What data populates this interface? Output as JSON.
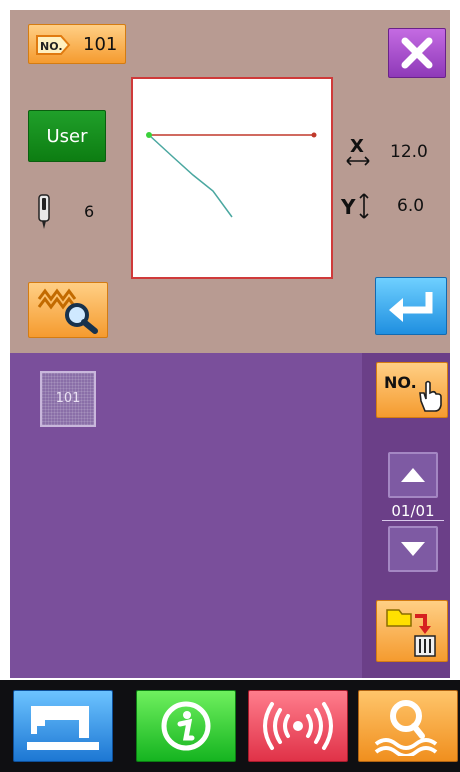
{
  "header": {
    "program_no_label": "NO.",
    "program_no": "101"
  },
  "params": {
    "needle_value": "6",
    "x_value": "12.0",
    "y_value": "6.0"
  },
  "buttons": {
    "user_label": "User",
    "no_select_label": "NO."
  },
  "pattern_list": {
    "items": [
      {
        "number": "101"
      }
    ]
  },
  "pager": {
    "text": "01/01"
  },
  "preview": {
    "line_color": "#c0392b",
    "stitch_color": "#4aa7a0",
    "start_point_color": "#3bd13b"
  },
  "colors": {
    "top_panel": "#b89b92",
    "list_panel": "#7a4f9b",
    "accent_orange": "#f59b2f",
    "accent_purple": "#8e39b8"
  },
  "icons": {
    "close": "close-icon",
    "needle": "needle-icon",
    "x_axis": "x-scale-icon",
    "y_axis": "y-scale-icon",
    "stitch_search": "stitch-search-icon",
    "enter": "enter-icon",
    "no_select": "hand-pointer-icon",
    "page_up": "triangle-up-icon",
    "page_down": "triangle-down-icon",
    "copy_delete": "copy-delete-icon",
    "sewing": "sewing-machine-icon",
    "info": "info-icon",
    "communication": "wireless-icon",
    "search": "search-icon"
  }
}
